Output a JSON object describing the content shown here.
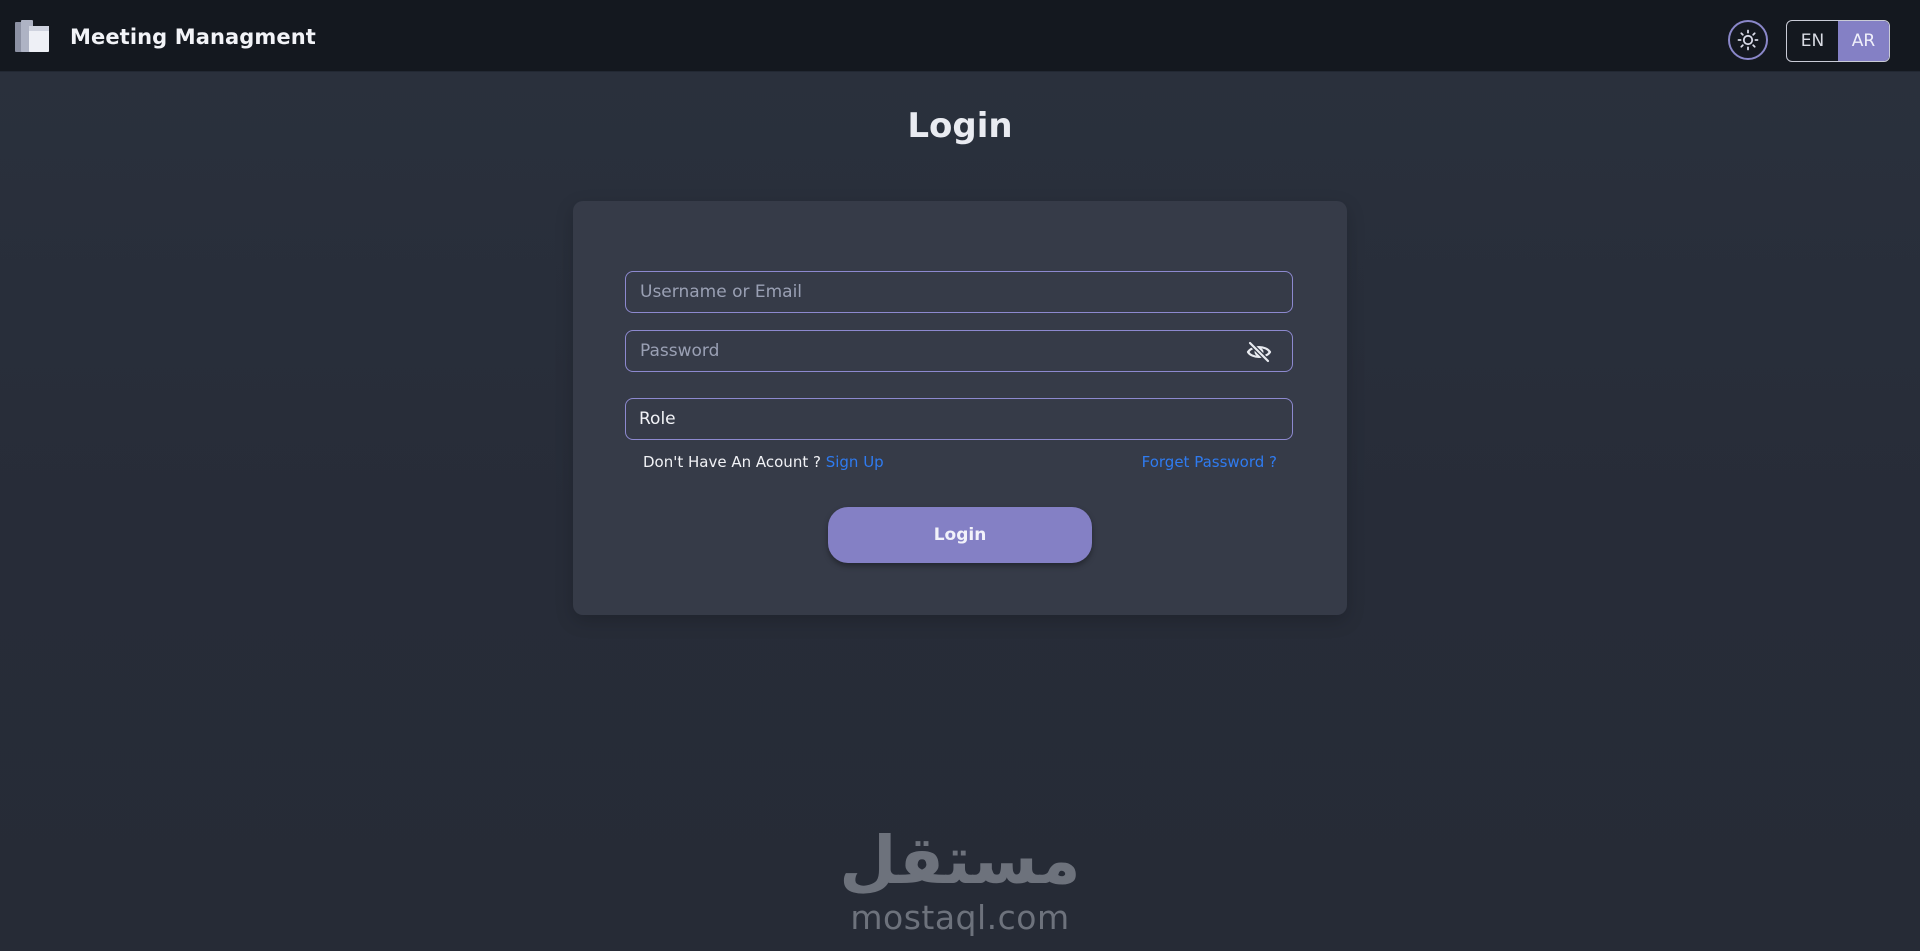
{
  "app": {
    "title": "Meeting Managment",
    "logo_icon": "folders-logo-icon"
  },
  "header": {
    "theme_toggle_icon": "sun-icon",
    "languages": [
      "EN",
      "AR"
    ],
    "active_language": "AR",
    "accent_color": "#8480c5"
  },
  "page": {
    "title": "Login"
  },
  "form": {
    "username_placeholder": "Username or Email",
    "password_placeholder": "Password",
    "password_visibility_icon": "eye-slash-icon",
    "role_value": "Role",
    "no_account_text": "Don't Have An Acount ?",
    "signup_label": "Sign Up",
    "forgot_label": "Forget Password ?",
    "submit_label": "Login",
    "link_color": "#2f7bf0"
  },
  "watermark": {
    "arabic": "مستقل",
    "latin": "mostaql.com"
  }
}
